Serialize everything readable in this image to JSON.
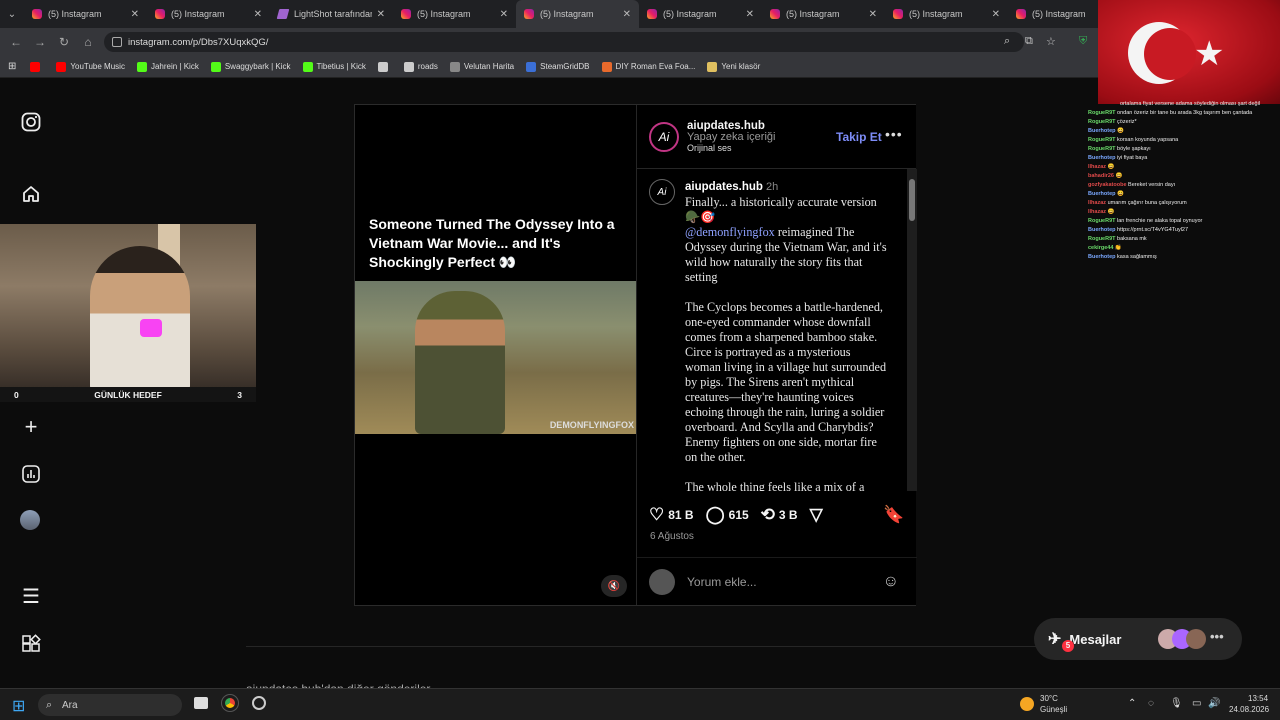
{
  "browser": {
    "tabs": [
      {
        "title": "(5) Instagram",
        "kind": "ig"
      },
      {
        "title": "(5) Instagram",
        "kind": "ig"
      },
      {
        "title": "LightShot tarafından",
        "kind": "ls"
      },
      {
        "title": "(5) Instagram",
        "kind": "ig"
      },
      {
        "title": "(5) Instagram",
        "kind": "ig",
        "active": true
      },
      {
        "title": "(5) Instagram",
        "kind": "ig"
      },
      {
        "title": "(5) Instagram",
        "kind": "ig"
      },
      {
        "title": "(5) Instagram",
        "kind": "ig"
      },
      {
        "title": "(5) Instagram",
        "kind": "ig"
      }
    ],
    "url": "instagram.com/p/Dbs7XUqxkQG/",
    "bookmarks": [
      {
        "label": "",
        "icon": "youtube-icon",
        "color": "#ff0000"
      },
      {
        "label": "YouTube Music",
        "icon": "youtube-music-icon",
        "color": "#ff0000"
      },
      {
        "label": "Jahrein | Kick",
        "icon": "kick-icon",
        "color": "#53fc18"
      },
      {
        "label": "Swaggybark | Kick",
        "icon": "kick-icon",
        "color": "#53fc18"
      },
      {
        "label": "Tibetius | Kick",
        "icon": "kick-icon",
        "color": "#53fc18"
      },
      {
        "label": "",
        "icon": "globe-icon",
        "color": "#cccccc"
      },
      {
        "label": "roads",
        "icon": "roads-icon",
        "color": "#cccccc"
      },
      {
        "label": "Velutan Harita",
        "icon": "map-icon",
        "color": "#888888"
      },
      {
        "label": "SteamGridDB",
        "icon": "steamgrid-icon",
        "color": "#3b6fd6"
      },
      {
        "label": "DIY Roman Eva Foa...",
        "icon": "diy-icon",
        "color": "#e86a2c"
      },
      {
        "label": "Yeni klasör",
        "icon": "folder-icon",
        "color": "#e0c060"
      }
    ]
  },
  "stream": {
    "goal_left": "0",
    "goal_label": "GÜNLÜK HEDEF",
    "goal_right": "3"
  },
  "post": {
    "video_title": "Someone Turned The Odyssey Into a Vietnam War Movie... and It's Shockingly Perfect 👀",
    "watermark": "DEMONFLYINGFOX",
    "author": "aiupdates.hub",
    "author_sub": "Yapay zeka içeriği",
    "audio": "Orijinal ses",
    "follow": "Takip Et",
    "comment_author": "aiupdates.hub",
    "comment_time": "2h",
    "caption_p1": "Finally... a historically accurate version 🪖🎯",
    "mention": "@demonflyingfox",
    "caption_p2": " reimagined The Odyssey during the Vietnam War, and it's wild how naturally the story fits that setting",
    "caption_p3": "The Cyclops becomes a battle-hardened, one-eyed commander whose downfall comes from a sharpened bamboo stake. Circe is portrayed as a mysterious woman living in a village hut surrounded by pigs. The Sirens aren't mythical creatures—they're haunting voices echoing through the rain, luring a soldier overboard. And Scylla and Charybdis? Enemy fighters on one side, mortar fire on the other.",
    "caption_p4": "The whole thing feels like a mix of a",
    "likes": "81 B",
    "comments": "615",
    "reposts": "3 B",
    "date": "6 Ağustos",
    "comment_placeholder": "Yorum ekle..."
  },
  "more_from": "aiupdates.hub'dan diğer gönderiler",
  "messages": {
    "label": "Mesajlar",
    "badge": "5"
  },
  "chat": [
    {
      "user": "",
      "text": "ortalama fiyat versene adama söylediğin olması şart değil",
      "color": "#ffffff"
    },
    {
      "user": "RogueR9T",
      "text": "ondan özeriz bir tane bu arada 3kg taşırım ben çantada",
      "color": "#6bdc6b"
    },
    {
      "user": "RogueR9T",
      "text": "çözeriz*",
      "color": "#6bdc6b"
    },
    {
      "user": "Buerhotep",
      "text": "😄",
      "color": "#7aa8ff"
    },
    {
      "user": "RogueR9T",
      "text": "korsan koyunda yapsana",
      "color": "#6bdc6b"
    },
    {
      "user": "RogueR9T",
      "text": "böyle şapkayı",
      "color": "#6bdc6b"
    },
    {
      "user": "Buerhotep",
      "text": "iyi fiyat baya",
      "color": "#7aa8ff"
    },
    {
      "user": "llhazaz",
      "text": "😄",
      "color": "#e04a4a"
    },
    {
      "user": "bahadir26",
      "text": "😄",
      "color": "#e04a4a"
    },
    {
      "user": "gozfyakatoobe",
      "text": "Bereket versin dayı",
      "color": "#e04a4a"
    },
    {
      "user": "Buerhotep",
      "text": "😄",
      "color": "#7aa8ff"
    },
    {
      "user": "llhazaz",
      "text": "umarım çağırır buna çalışıyorum",
      "color": "#e04a4a"
    },
    {
      "user": "llhazaz",
      "text": "😄",
      "color": "#e04a4a"
    },
    {
      "user": "RogueR9T",
      "text": "lan frenchie ne alaka topal oynuyor",
      "color": "#6bdc6b"
    },
    {
      "user": "Buerhotep",
      "text": "https://prnt.sc/T4vYG4Tuyl27",
      "color": "#7aa8ff"
    },
    {
      "user": "RogueR9T",
      "text": "baksana mk",
      "color": "#6bdc6b"
    },
    {
      "user": "cekirge44",
      "text": "👏",
      "color": "#6bdc6b"
    },
    {
      "user": "Buerhotep",
      "text": "kasa sağlammış",
      "color": "#7aa8ff"
    }
  ],
  "taskbar": {
    "search": "Ara",
    "weather_temp": "30°C",
    "weather_desc": "Güneşli",
    "time": "13:54",
    "date": "24.08.2026"
  }
}
